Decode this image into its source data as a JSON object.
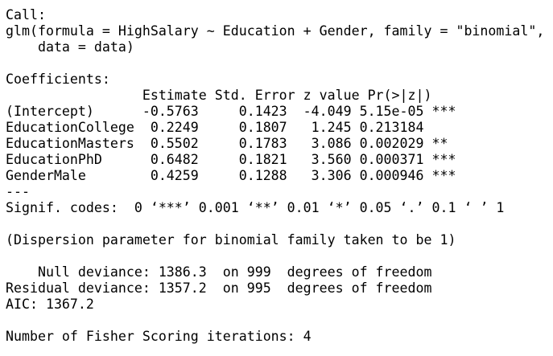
{
  "output": {
    "lines": [
      "Call:",
      "glm(formula = HighSalary ~ Education + Gender, family = \"binomial\",",
      "    data = data)",
      "",
      "Coefficients:",
      "                 Estimate Std. Error z value Pr(>|z|)    ",
      "(Intercept)      -0.5763     0.1423  -4.049 5.15e-05 ***",
      "EducationCollege  0.2249     0.1807   1.245 0.213184    ",
      "EducationMasters  0.5502     0.1783   3.086 0.002029 ** ",
      "EducationPhD      0.6482     0.1821   3.560 0.000371 ***",
      "GenderMale        0.4259     0.1288   3.306 0.000946 ***",
      "---",
      "Signif. codes:  0 ‘***’ 0.001 ‘**’ 0.01 ‘*’ 0.05 ‘.’ 0.1 ‘ ’ 1",
      "",
      "(Dispersion parameter for binomial family taken to be 1)",
      "",
      "    Null deviance: 1386.3  on 999  degrees of freedom",
      "Residual deviance: 1357.2  on 995  degrees of freedom",
      "AIC: 1367.2",
      "",
      "Number of Fisher Scoring iterations: 4"
    ]
  }
}
